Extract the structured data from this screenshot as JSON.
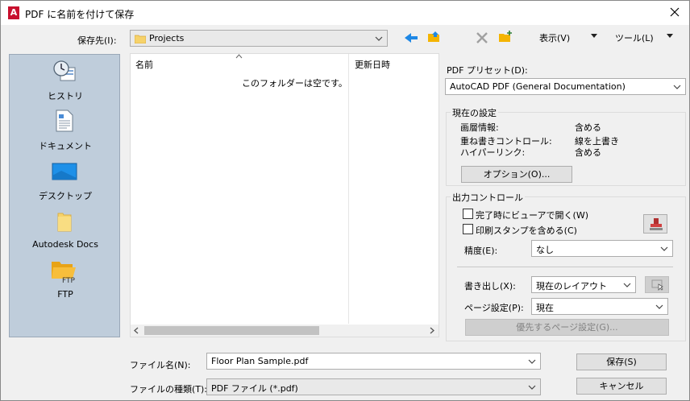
{
  "window": {
    "title": "PDF に名前を付けて保存",
    "app_icon_letter": "A"
  },
  "toolbar": {
    "save_in_label": "保存先(I):",
    "save_in_value": "Projects",
    "view_label": "表示(V)",
    "tools_label": "ツール(L)",
    "icons": [
      "back-arrow-icon",
      "folder-up-icon",
      "delete-icon",
      "new-folder-icon"
    ]
  },
  "places": [
    {
      "label": "ヒストリ",
      "icon": "history-icon"
    },
    {
      "label": "ドキュメント",
      "icon": "documents-icon"
    },
    {
      "label": "デスクトップ",
      "icon": "desktop-icon"
    },
    {
      "label": "Autodesk Docs",
      "icon": "autodesk-docs-icon"
    },
    {
      "label": "FTP",
      "icon": "ftp-folder-icon"
    }
  ],
  "filelist": {
    "col_name": "名前",
    "col_modified": "更新日時",
    "empty_message": "このフォルダーは空です。"
  },
  "bottom": {
    "filename_label": "ファイル名(N):",
    "filename_value": "Floor Plan Sample.pdf",
    "filetype_label": "ファイルの種類(T):",
    "filetype_value": "PDF ファイル (*.pdf)",
    "save_button": "保存(S)",
    "cancel_button": "キャンセル"
  },
  "pdf_preset": {
    "label": "PDF プリセット(D):",
    "value": "AutoCAD PDF (General Documentation)"
  },
  "current_settings": {
    "title": "現在の設定",
    "rows": [
      {
        "name": "画層情報:",
        "value": "含める"
      },
      {
        "name": "重ね書きコントロール:",
        "value": "線を上書き"
      },
      {
        "name": "ハイパーリンク:",
        "value": "含める"
      }
    ],
    "options_button": "オプション(O)..."
  },
  "output_control": {
    "title": "出力コントロール",
    "open_viewer_label": "完了時にビューアで開く(W)",
    "include_stamp_label": "印刷スタンプを含める(C)",
    "precision_label": "精度(E):",
    "precision_value": "なし",
    "export_label": "書き出し(X):",
    "export_value": "現在のレイアウト",
    "page_setup_label": "ページ設定(P):",
    "page_setup_value": "現在",
    "override_button": "優先するページ設定(G)..."
  }
}
